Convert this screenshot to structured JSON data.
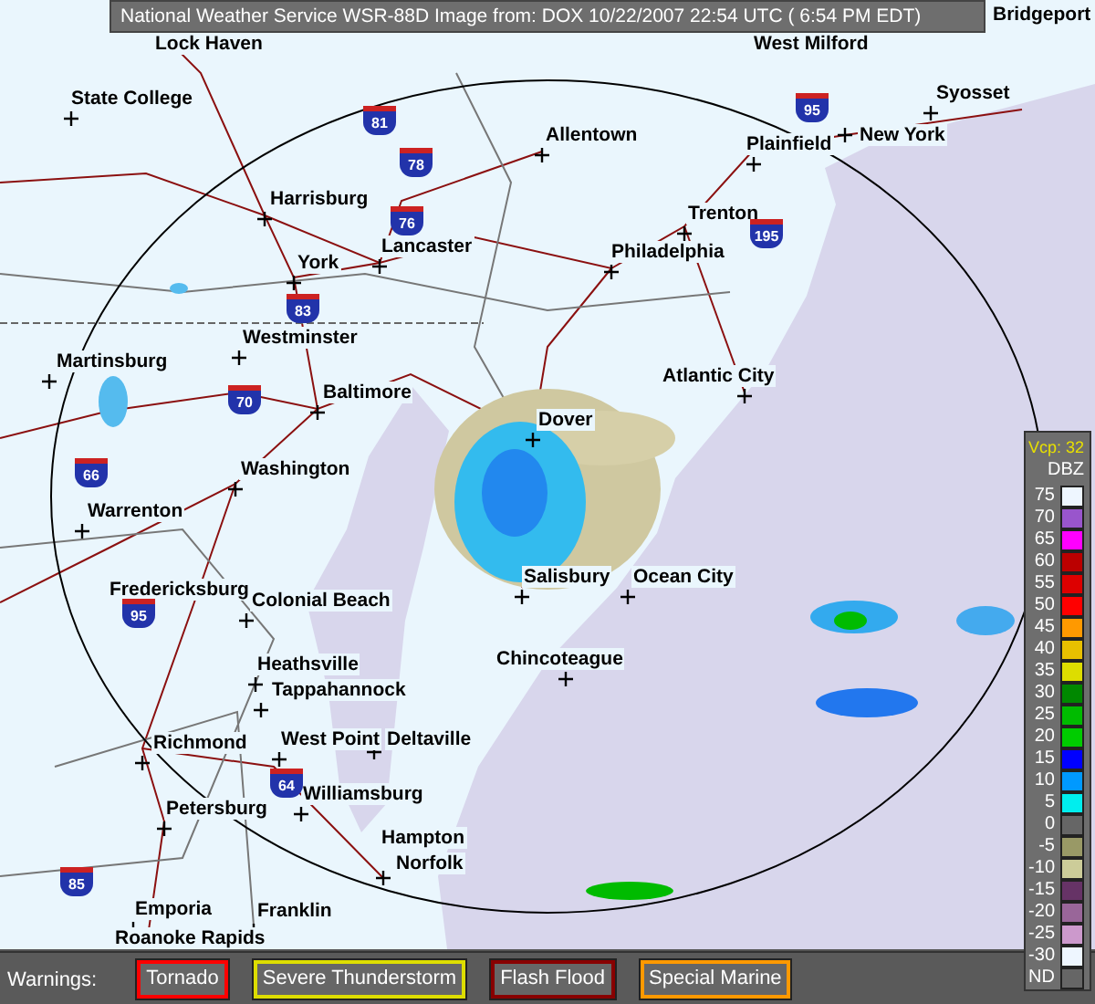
{
  "header": {
    "title": "National Weather Service WSR-88D Image from: DOX 10/22/2007 22:54 UTC ( 6:54 PM EDT)"
  },
  "map": {
    "cities": [
      {
        "name": "Lock Haven"
      },
      {
        "name": "West Milford"
      },
      {
        "name": "Bridgeport"
      },
      {
        "name": "State College"
      },
      {
        "name": "Harrisburg"
      },
      {
        "name": "Allentown"
      },
      {
        "name": "Plainfield"
      },
      {
        "name": "New York"
      },
      {
        "name": "Syosset"
      },
      {
        "name": "Lancaster"
      },
      {
        "name": "Trenton"
      },
      {
        "name": "Philadelphia"
      },
      {
        "name": "York"
      },
      {
        "name": "Westminster"
      },
      {
        "name": "Martinsburg"
      },
      {
        "name": "Baltimore"
      },
      {
        "name": "Atlantic City"
      },
      {
        "name": "Dover"
      },
      {
        "name": "Washington"
      },
      {
        "name": "Warrenton"
      },
      {
        "name": "Salisbury"
      },
      {
        "name": "Ocean City"
      },
      {
        "name": "Fredericksburg"
      },
      {
        "name": "Colonial Beach"
      },
      {
        "name": "Heathsville"
      },
      {
        "name": "Tappahannock"
      },
      {
        "name": "Chincoteague"
      },
      {
        "name": "Richmond"
      },
      {
        "name": "West Point"
      },
      {
        "name": "Deltaville"
      },
      {
        "name": "Williamsburg"
      },
      {
        "name": "Petersburg"
      },
      {
        "name": "Hampton"
      },
      {
        "name": "Norfolk"
      },
      {
        "name": "Emporia"
      },
      {
        "name": "Franklin"
      },
      {
        "name": "Roanoke Rapids"
      }
    ],
    "highways": [
      {
        "number": "81"
      },
      {
        "number": "78"
      },
      {
        "number": "76"
      },
      {
        "number": "83"
      },
      {
        "number": "70"
      },
      {
        "number": "66"
      },
      {
        "number": "95"
      },
      {
        "number": "195"
      },
      {
        "number": "95"
      },
      {
        "number": "64"
      },
      {
        "number": "85"
      }
    ]
  },
  "legend": {
    "vcp": "Vcp: 32",
    "unit": "DBZ",
    "levels": [
      {
        "label": "75",
        "color": "#eef6ff"
      },
      {
        "label": "70",
        "color": "#9955cc"
      },
      {
        "label": "65",
        "color": "#ff00ff"
      },
      {
        "label": "60",
        "color": "#bb0000"
      },
      {
        "label": "55",
        "color": "#dd0000"
      },
      {
        "label": "50",
        "color": "#ff0000"
      },
      {
        "label": "45",
        "color": "#ff9900"
      },
      {
        "label": "40",
        "color": "#e8c000"
      },
      {
        "label": "35",
        "color": "#dddd00"
      },
      {
        "label": "30",
        "color": "#008800"
      },
      {
        "label": "25",
        "color": "#00bb00"
      },
      {
        "label": "20",
        "color": "#00cc00"
      },
      {
        "label": "15",
        "color": "#0000ff"
      },
      {
        "label": "10",
        "color": "#0099ff"
      },
      {
        "label": "5",
        "color": "#00eeee"
      },
      {
        "label": "0",
        "color": "#666666"
      },
      {
        "label": "-5",
        "color": "#999966"
      },
      {
        "label": "-10",
        "color": "#cccc99"
      },
      {
        "label": "-15",
        "color": "#663366"
      },
      {
        "label": "-20",
        "color": "#996699"
      },
      {
        "label": "-25",
        "color": "#cc99cc"
      },
      {
        "label": "-30",
        "color": "#eef6ff"
      },
      {
        "label": "ND",
        "color": "#666666"
      }
    ]
  },
  "warnings": {
    "label": "Warnings:",
    "items": [
      {
        "name": "Tornado",
        "color": "#ff0000"
      },
      {
        "name": "Severe Thunderstorm",
        "color": "#dddd00"
      },
      {
        "name": "Flash Flood",
        "color": "#880000"
      },
      {
        "name": "Special Marine",
        "color": "#ff9900"
      }
    ]
  }
}
